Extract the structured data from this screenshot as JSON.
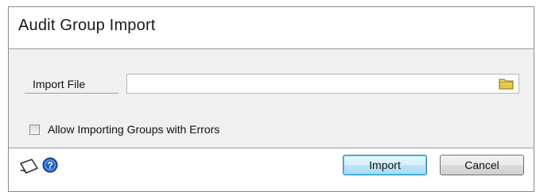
{
  "dialog": {
    "title": "Audit Group Import"
  },
  "form": {
    "import_file_label": "Import File",
    "import_file_value": "",
    "allow_errors_label": "Allow Importing Groups with Errors",
    "allow_errors_checked": false
  },
  "buttons": {
    "import_label": "Import",
    "cancel_label": "Cancel"
  },
  "icons": {
    "browse": "folder-icon",
    "note": "note-icon",
    "help": "help-icon"
  },
  "colors": {
    "panel_background": "#f0f0f0",
    "default_button_border": "#3c7fb1",
    "folder_yellow": "#e8c840",
    "help_blue": "#1f5fbf"
  }
}
